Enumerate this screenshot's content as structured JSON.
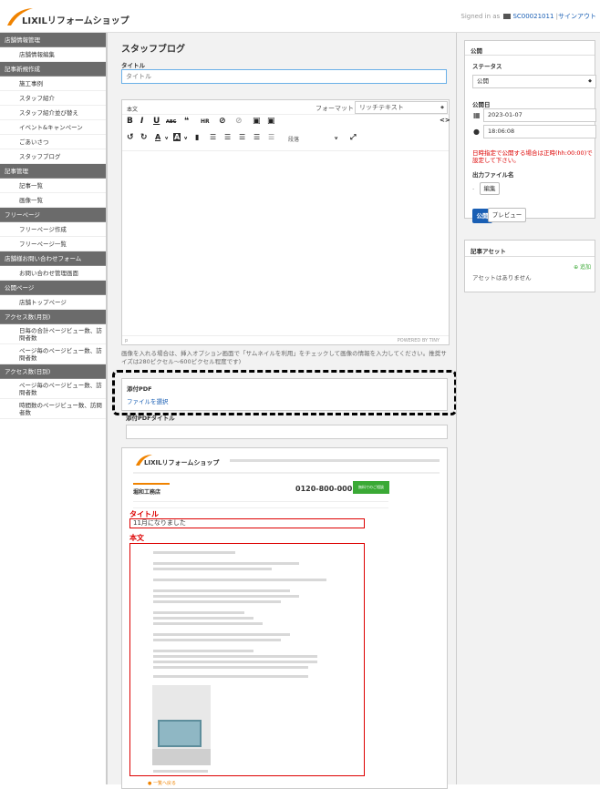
{
  "header": {
    "logo_text": "LIXILリフォームショップ",
    "signed_in_prefix": "Signed in as",
    "account_id": "SC00021011",
    "separator": "|",
    "signout_label": "サインアウト"
  },
  "sidebar": {
    "items": [
      {
        "type": "head",
        "label": "店舗情報管理"
      },
      {
        "type": "item",
        "label": "店舗情報編集"
      },
      {
        "type": "head",
        "label": "記事新規作成"
      },
      {
        "type": "item",
        "label": "施工事例"
      },
      {
        "type": "item",
        "label": "スタッフ紹介"
      },
      {
        "type": "item",
        "label": "スタッフ紹介並び替え"
      },
      {
        "type": "item",
        "label": "イベント&キャンペーン"
      },
      {
        "type": "item",
        "label": "ごあいさつ"
      },
      {
        "type": "item",
        "label": "スタッフブログ"
      },
      {
        "type": "head",
        "label": "記事管理"
      },
      {
        "type": "item",
        "label": "記事一覧"
      },
      {
        "type": "item",
        "label": "画像一覧"
      },
      {
        "type": "head",
        "label": "フリーページ"
      },
      {
        "type": "item",
        "label": "フリーページ作成"
      },
      {
        "type": "item",
        "label": "フリーページ一覧"
      },
      {
        "type": "head",
        "label": "店舗様お問い合わせフォーム"
      },
      {
        "type": "item",
        "label": "お問い合わせ管理画面"
      },
      {
        "type": "head",
        "label": "公開ページ"
      },
      {
        "type": "item",
        "label": "店舗トップページ"
      },
      {
        "type": "head",
        "label": "アクセス数(月別)"
      },
      {
        "type": "two",
        "label": "日毎の合計ページビュー数、訪問者数"
      },
      {
        "type": "two",
        "label": "ページ毎のページビュー数、訪問者数"
      },
      {
        "type": "head",
        "label": "アクセス数(日別)"
      },
      {
        "type": "two",
        "label": "ページ毎のページビュー数、訪問者数"
      },
      {
        "type": "two",
        "label": "時間数のページビュー数、訪問者数"
      }
    ]
  },
  "main": {
    "page_title": "スタッフブログ",
    "title_label": "タイトル",
    "title_placeholder": "タイトル",
    "editor": {
      "tab_label": "本文",
      "format_label": "フォーマット",
      "format_value": "リッチテキスト",
      "paragraph_value": "段落",
      "footer_left": "p",
      "footer_right": "POWERED BY TINY"
    },
    "image_note": "画像を入れる場合は、挿入オプション画面で「サムネイルを利用」をチェックして画像の情報を入力してください。推奨サイズは280ピクセル～600ピクセル程度です)",
    "pdf_label": "添付PDF",
    "pdf_link": "ファイルを選択",
    "pdf_title_label": "添付PDFタイトル",
    "preview": {
      "logo_text": "LIXILリフォームショップ",
      "shop_name": "堀和工務店",
      "phone": "0120-800-000",
      "contact_button": "無料でのご相談",
      "title_heading": "タイトル",
      "title_value": "11月になりました",
      "body_heading": "本文",
      "footer_link": "一覧へ戻る"
    }
  },
  "right": {
    "publish_header": "公開",
    "status_label": "ステータス",
    "status_value": "公開",
    "date_label": "公開日",
    "date_value": "2023-01-07",
    "time_value": "18:06:08",
    "date_warning": "日時指定で公開する場合は正時(hh:00:00)で設定して下さい。",
    "output_file_label": "出力ファイル名",
    "output_dash": "-",
    "edit_button": "編集",
    "publish_button": "公開",
    "preview_button": "プレビュー",
    "asset_header": "記事アセット",
    "add_label": "⊕ 追加",
    "no_asset": "アセットはありません"
  },
  "colors": {
    "sidebar_head": "#6b6b6b",
    "accent": "#1a5fb4",
    "warning": "#dd0000",
    "logo_orange": "#f08300",
    "preview_red": "#dd0000",
    "preview_green": "#3aa935"
  }
}
